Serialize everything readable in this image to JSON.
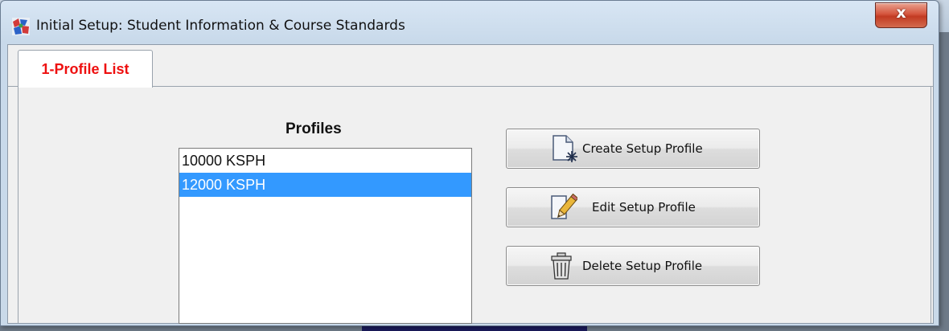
{
  "window": {
    "title": "Initial Setup: Student Information & Course Standards",
    "close_glyph": "x",
    "icon": "app-icon"
  },
  "tabs": [
    {
      "label": "1-Profile List",
      "selected": true,
      "color": "#ee1010"
    }
  ],
  "profiles": {
    "label": "Profiles",
    "items": [
      {
        "label": "10000 KSPH",
        "selected": false
      },
      {
        "label": "12000 KSPH",
        "selected": true
      }
    ],
    "selection_color": "#3399ff"
  },
  "buttons": {
    "create": {
      "label": "Create Setup Profile",
      "icon": "new-document-icon"
    },
    "edit": {
      "label": "Edit Setup Profile",
      "icon": "edit-pencil-icon"
    },
    "delete": {
      "label": "Delete Setup Profile",
      "icon": "trash-can-icon"
    }
  }
}
